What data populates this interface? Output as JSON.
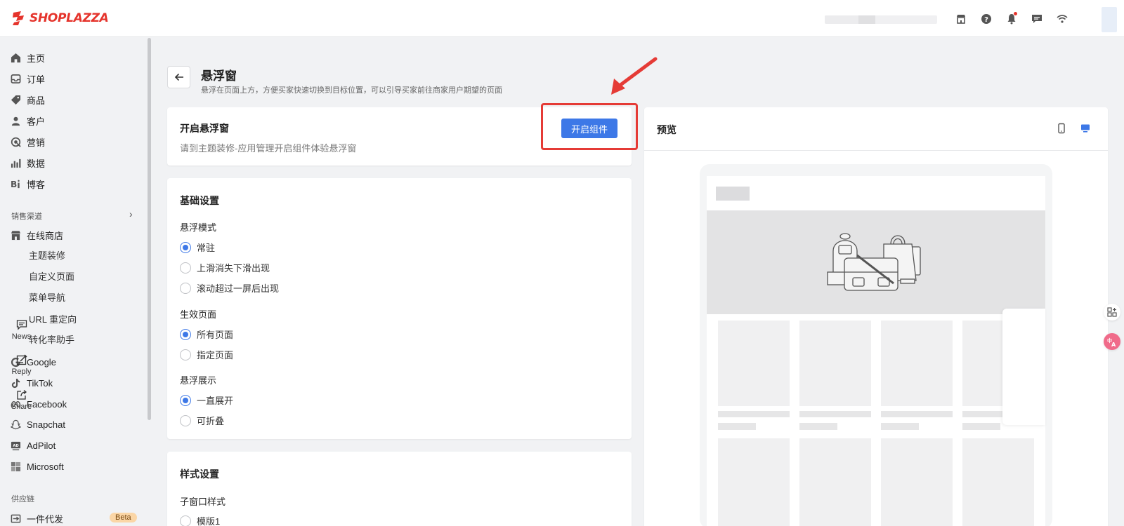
{
  "brand": {
    "name": "SHOPLAZZA",
    "color": "#e5342c"
  },
  "topbar": {
    "icons": [
      "store-icon",
      "help-icon",
      "bell-icon",
      "chat-icon",
      "wifi-icon"
    ]
  },
  "sidebar": {
    "items": [
      {
        "label": "主页",
        "icon": "home-icon"
      },
      {
        "label": "订单",
        "icon": "inbox-icon"
      },
      {
        "label": "商品",
        "icon": "tag-icon"
      },
      {
        "label": "客户",
        "icon": "person-icon"
      },
      {
        "label": "营销",
        "icon": "target-icon"
      },
      {
        "label": "数据",
        "icon": "bar-chart-icon"
      },
      {
        "label": "博客",
        "icon": "blog-icon"
      }
    ],
    "sales_channel_label": "销售渠道",
    "online_store": {
      "label": "在线商店",
      "icon": "store-icon"
    },
    "sub_items": [
      "主题装修",
      "自定义页面",
      "菜单导航",
      "URL 重定向",
      "转化率助手"
    ],
    "channels": [
      {
        "label": "Google",
        "icon": "google-icon"
      },
      {
        "label": "TikTok",
        "icon": "tiktok-icon"
      },
      {
        "label": "Facebook",
        "icon": "meta-icon"
      },
      {
        "label": "Snapchat",
        "icon": "snapchat-icon"
      },
      {
        "label": "AdPilot",
        "icon": "ad-icon"
      },
      {
        "label": "Microsoft",
        "icon": "microsoft-icon"
      }
    ],
    "supply_chain_label": "供应链",
    "dropship": {
      "label": "一件代发",
      "badge": "Beta"
    }
  },
  "header": {
    "title": "悬浮窗",
    "subtitle": "悬浮在页面上方，方便买家快速切换到目标位置，可以引导买家前往商家用户期望的页面"
  },
  "enable_card": {
    "title": "开启悬浮窗",
    "description": "请到主题装修-应用管理开启组件体验悬浮窗",
    "button_label": "开启组件",
    "accent": "#3d78e7"
  },
  "basic_settings": {
    "title": "基础设置",
    "mode_label": "悬浮模式",
    "mode_options": [
      "常驻",
      "上滑消失下滑出现",
      "滚动超过一屏后出现"
    ],
    "mode_selected": 0,
    "pages_label": "生效页面",
    "pages_options": [
      "所有页面",
      "指定页面"
    ],
    "pages_selected": 0,
    "display_label": "悬浮展示",
    "display_options": [
      "一直展开",
      "可折叠"
    ],
    "display_selected": 0
  },
  "style_settings": {
    "title": "样式设置",
    "window_style_label": "子窗口样式",
    "window_options": [
      "模版1"
    ]
  },
  "preview": {
    "title": "预览",
    "float_items": [
      {
        "label": "News",
        "icon": "message-icon"
      },
      {
        "label": "Reply",
        "icon": "edit-icon"
      },
      {
        "label": "Share",
        "icon": "share-icon"
      }
    ]
  },
  "annotation_color": "#e53b36"
}
